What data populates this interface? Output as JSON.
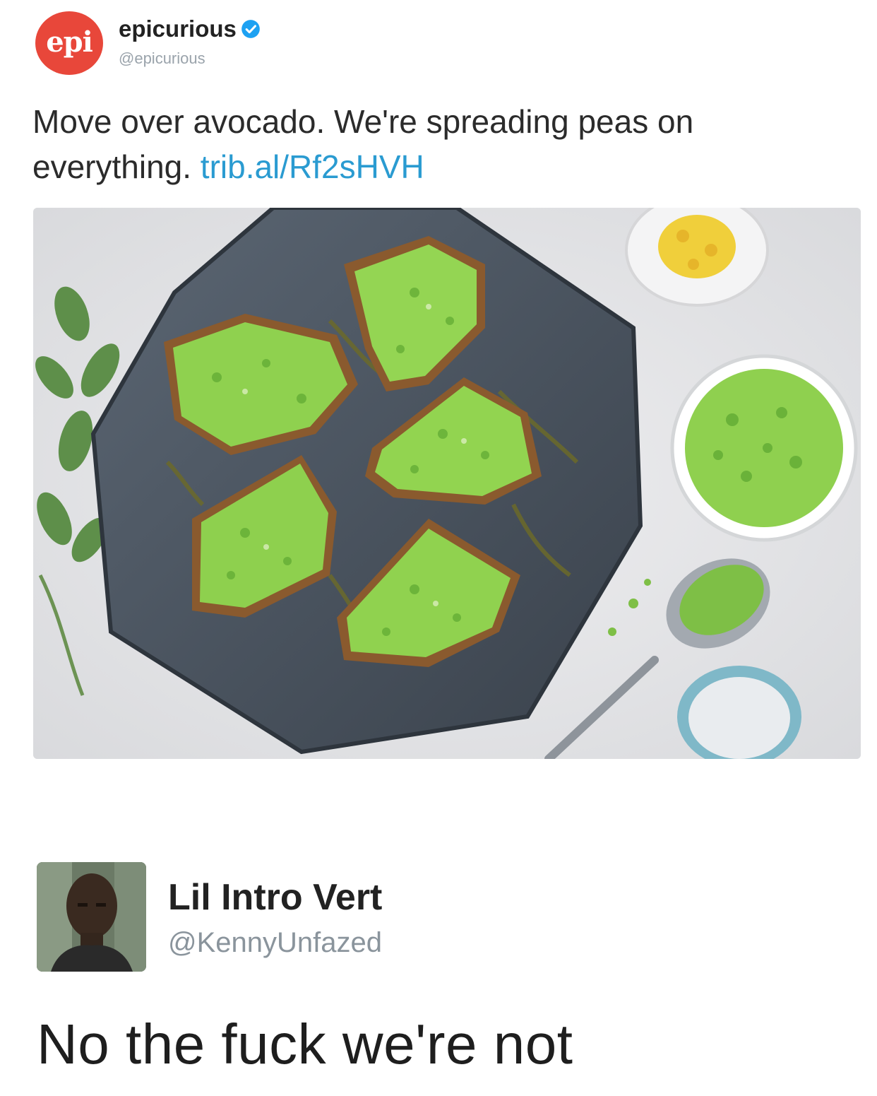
{
  "tweet1": {
    "avatar_text": "epi",
    "name": "epicurious",
    "handle": "@epicurious",
    "verified_icon": "verified-badge-icon",
    "text": "Move over avocado. We're spreading peas on everything.",
    "link": "trib.al/Rf2sHVH",
    "image_alt": "pea spread on toast on a hexagonal slate board"
  },
  "tweet2": {
    "name": "Lil Intro Vert",
    "handle": "@KennyUnfazed",
    "text": "No the fuck we're not"
  },
  "colors": {
    "brand_red": "#e8473a",
    "link_blue": "#2a9bd1",
    "verified_blue": "#1da1f2"
  }
}
